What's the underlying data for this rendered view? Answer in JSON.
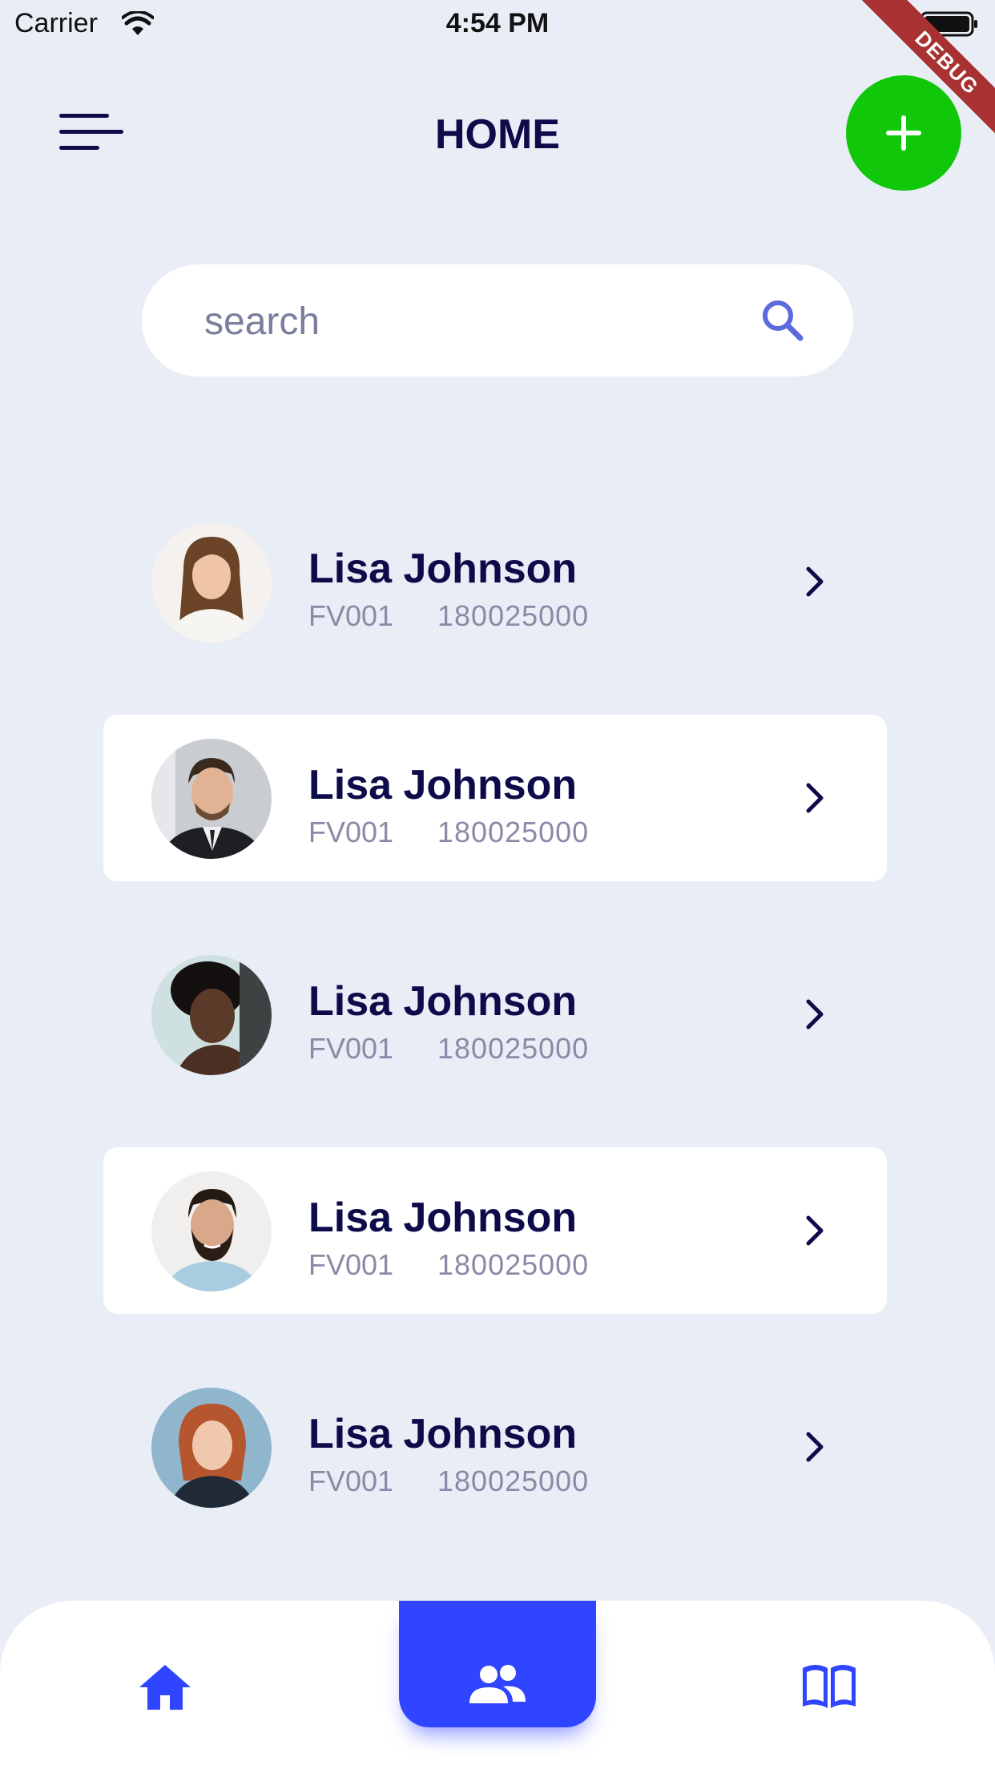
{
  "status_bar": {
    "carrier": "Carrier",
    "time": "4:54 PM"
  },
  "debug_banner": "DEBUG",
  "header": {
    "title": "HOME",
    "menu_icon": "menu-icon",
    "add_icon": "plus-icon"
  },
  "search": {
    "placeholder": "search",
    "icon": "search-icon"
  },
  "contacts": [
    {
      "name": "Lisa Johnson",
      "code": "FV001",
      "phone": "180025000",
      "selected": false
    },
    {
      "name": "Lisa Johnson",
      "code": "FV001",
      "phone": "180025000",
      "selected": true
    },
    {
      "name": "Lisa Johnson",
      "code": "FV001",
      "phone": "180025000",
      "selected": false
    },
    {
      "name": "Lisa Johnson",
      "code": "FV001",
      "phone": "180025000",
      "selected": true
    },
    {
      "name": "Lisa Johnson",
      "code": "FV001",
      "phone": "180025000",
      "selected": false
    }
  ],
  "bottom_nav": {
    "items": [
      {
        "icon": "home-icon",
        "active": false
      },
      {
        "icon": "people-icon",
        "active": true
      },
      {
        "icon": "book-icon",
        "active": false
      }
    ]
  },
  "colors": {
    "background": "#e9edf5",
    "primary_text": "#0e0b4a",
    "secondary_text": "#8a8aa8",
    "accent_blue": "#2f45ff",
    "add_button_green": "#10c70a",
    "debug_ribbon": "#a83232"
  }
}
